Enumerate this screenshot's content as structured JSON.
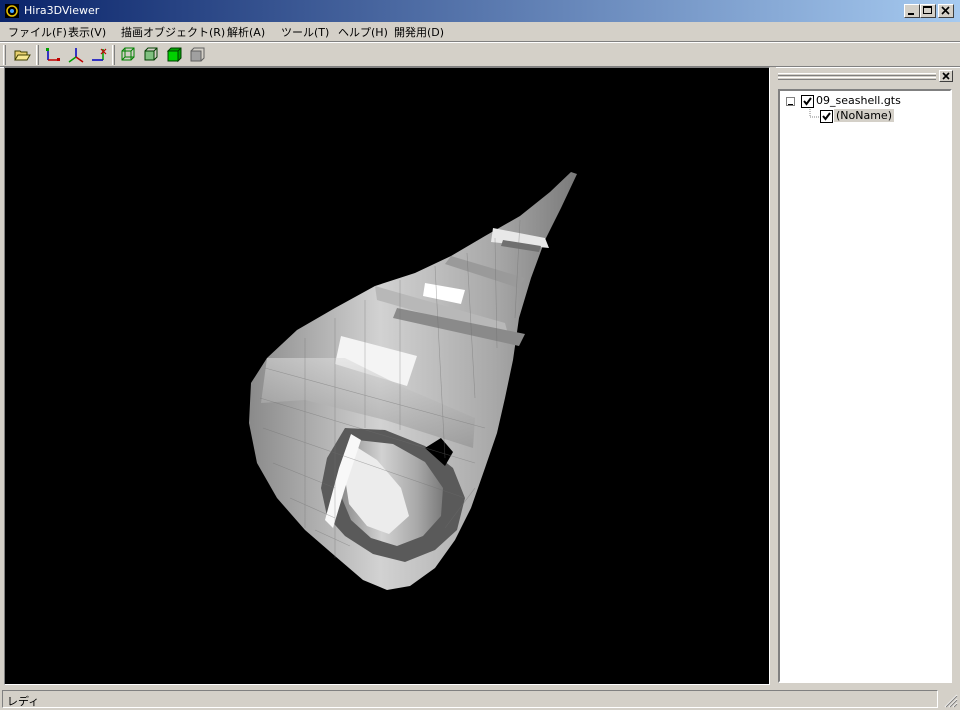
{
  "window": {
    "title": "Hira3DViewer",
    "icon": "app-logo-icon",
    "controls": [
      "minimize-icon",
      "maximize-icon",
      "close-icon"
    ]
  },
  "menu": {
    "file": "ファイル(F)",
    "view": "表示(V)",
    "draw_object": "描画オブジェクト(R)",
    "analysis": "解析(A)",
    "tools": "ツール(T)",
    "help": "ヘルプ(H)",
    "dev": "開発用(D)"
  },
  "toolbar": {
    "buttons": [
      "open-folder-icon",
      "axis-xy-icon",
      "axis-yz-icon",
      "axis-zx-icon",
      "wireframe-icon",
      "edges-icon",
      "solid-cube-icon",
      "disabled-render-icon"
    ]
  },
  "viewport": {
    "background": "#000000",
    "object_color": "#c8c8c8"
  },
  "tree": {
    "root_label": "09_seashell.gts",
    "root_checked": true,
    "child_label": "(NoName)",
    "child_checked": true
  },
  "status": {
    "text": "レディ"
  }
}
